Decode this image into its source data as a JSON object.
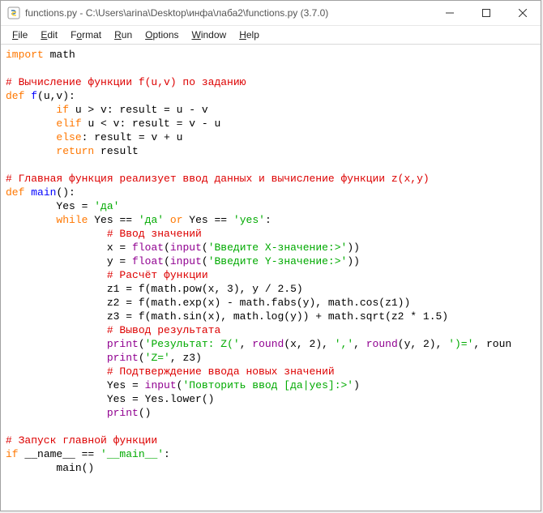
{
  "window": {
    "title": "functions.py - C:\\Users\\arina\\Desktop\\инфа\\лаба2\\functions.py (3.7.0)"
  },
  "menu": {
    "file": {
      "u": "F",
      "rest": "ile"
    },
    "edit": {
      "u": "E",
      "rest": "dit"
    },
    "format": {
      "pre": "F",
      "u": "o",
      "rest": "rmat"
    },
    "run": {
      "u": "R",
      "rest": "un"
    },
    "options": {
      "u": "O",
      "rest": "ptions"
    },
    "window": {
      "u": "W",
      "rest": "indow"
    },
    "help": {
      "u": "H",
      "rest": "elp"
    }
  },
  "code": {
    "l1": {
      "kw": "import",
      "sp": " ",
      "id": "math"
    },
    "c1": "# Вычисление функции f(u,v) по заданию",
    "l2": {
      "kw": "def",
      "sp": " ",
      "name": "f",
      "args": "(u,v):"
    },
    "l3": {
      "ind": "        ",
      "kw": "if",
      "body": " u > v: result = u - v"
    },
    "l4": {
      "ind": "        ",
      "kw": "elif",
      "body": " u < v: result = v - u"
    },
    "l5": {
      "ind": "        ",
      "kw": "else",
      "body": ": result = v + u"
    },
    "l6": {
      "ind": "        ",
      "kw": "return",
      "body": " result"
    },
    "c2": "# Главная функция реализует ввод данных и вычисление функции z(x,y)",
    "l7": {
      "kw": "def",
      "sp": " ",
      "name": "main",
      "args": "():"
    },
    "l8": {
      "ind": "        ",
      "a": "Yes = ",
      "s": "'да'"
    },
    "l9": {
      "ind": "        ",
      "kw": "while",
      "a": " Yes == ",
      "s1": "'да'",
      "b": " ",
      "kw2": "or",
      "c": " Yes == ",
      "s2": "'yes'",
      "d": ":"
    },
    "c3": {
      "ind": "                ",
      "t": "# Ввод значений"
    },
    "l10": {
      "ind": "                ",
      "a": "x = ",
      "bi1": "float",
      "b": "(",
      "bi2": "input",
      "c": "(",
      "s": "'Введите X-значение:>'",
      "d": "))"
    },
    "l11": {
      "ind": "                ",
      "a": "y = ",
      "bi1": "float",
      "b": "(",
      "bi2": "input",
      "c": "(",
      "s": "'Введите Y-значение:>'",
      "d": "))"
    },
    "c4": {
      "ind": "                ",
      "t": "# Расчёт функции"
    },
    "l12": {
      "ind": "                ",
      "t": "z1 = f(math.pow(x, 3), y / 2.5)"
    },
    "l13": {
      "ind": "                ",
      "t": "z2 = f(math.exp(x) - math.fabs(y), math.cos(z1))"
    },
    "l14": {
      "ind": "                ",
      "t": "z3 = f(math.sin(x), math.log(y)) + math.sqrt(z2 * 1.5)"
    },
    "c5": {
      "ind": "                ",
      "t": "# Вывод результата"
    },
    "l15": {
      "ind": "                ",
      "bi": "print",
      "a": "(",
      "s1": "'Результат: Z('",
      "b": ", ",
      "bi2": "round",
      "c": "(x, 2), ",
      "s2": "','",
      "d": ", ",
      "bi3": "round",
      "e": "(y, 2), ",
      "s3": "')='",
      "f": ", roun"
    },
    "l16": {
      "ind": "                ",
      "bi": "print",
      "a": "(",
      "s": "'Z='",
      "b": ", z3)"
    },
    "c6": {
      "ind": "                ",
      "t": "# Подтверждение ввода новых значений"
    },
    "l17": {
      "ind": "                ",
      "a": "Yes = ",
      "bi": "input",
      "b": "(",
      "s": "'Повторить ввод [да|yes]:>'",
      "c": ")"
    },
    "l18": {
      "ind": "                ",
      "t": "Yes = Yes.lower()"
    },
    "l19": {
      "ind": "                ",
      "bi": "print",
      "a": "()"
    },
    "c7": "# Запуск главной функции",
    "l20": {
      "kw": "if",
      "a": " __name__ == ",
      "s": "'__main__'",
      "b": ":"
    },
    "l21": {
      "ind": "        ",
      "t": "main()"
    }
  }
}
